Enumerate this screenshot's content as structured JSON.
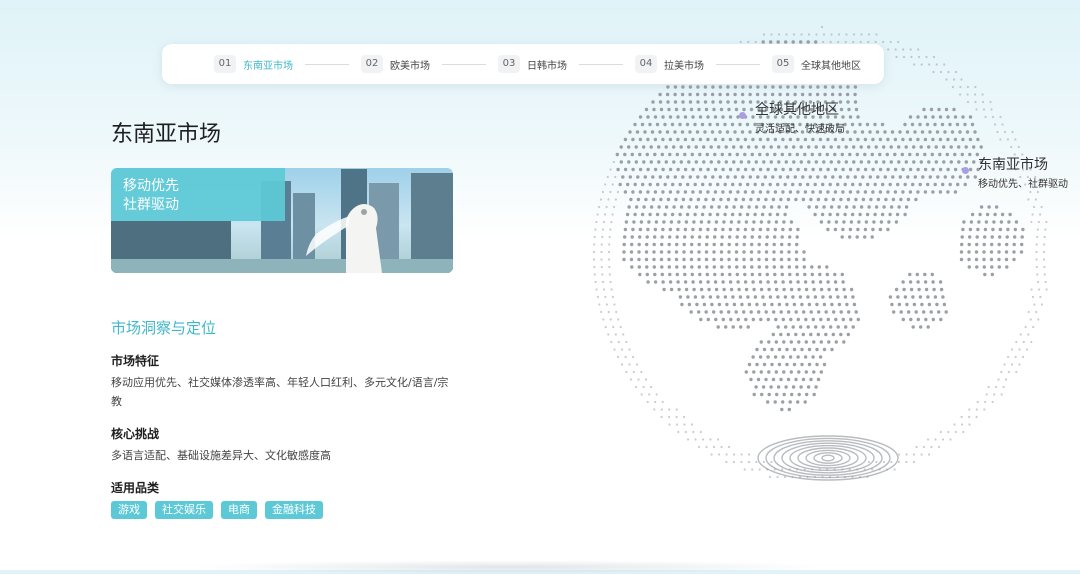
{
  "tabs": [
    {
      "num": "01",
      "label": "东南亚市场",
      "active": true
    },
    {
      "num": "02",
      "label": "欧美市场",
      "active": false
    },
    {
      "num": "03",
      "label": "日韩市场",
      "active": false
    },
    {
      "num": "04",
      "label": "拉美市场",
      "active": false
    },
    {
      "num": "05",
      "label": "全球其他地区",
      "active": false
    }
  ],
  "page_title": "东南亚市场",
  "banner": {
    "line1": "移动优先",
    "line2": "社群驱动",
    "image": "merlion-singapore-skyline"
  },
  "insight": {
    "heading": "市场洞察与定位",
    "features_title": "市场特征",
    "features_text": "移动应用优先、社交媒体渗透率高、年轻人口红利、多元文化/语言/宗教",
    "challenges_title": "核心挑战",
    "challenges_text": "多语言适配、基础设施差异大、文化敏感度高",
    "categories_title": "适用品类",
    "categories": [
      "游戏",
      "社交娱乐",
      "电商",
      "金融科技"
    ]
  },
  "globe": {
    "markers": [
      {
        "title": "全球其他地区",
        "subtitle": "灵活适配、快速破局"
      },
      {
        "title": "东南亚市场",
        "subtitle": "移动优先、社群驱动"
      }
    ]
  },
  "colors": {
    "accent": "#3fb7c9",
    "chip": "#5ec9d6",
    "marker": "#a99ee4",
    "dot": "#8a8f96"
  }
}
